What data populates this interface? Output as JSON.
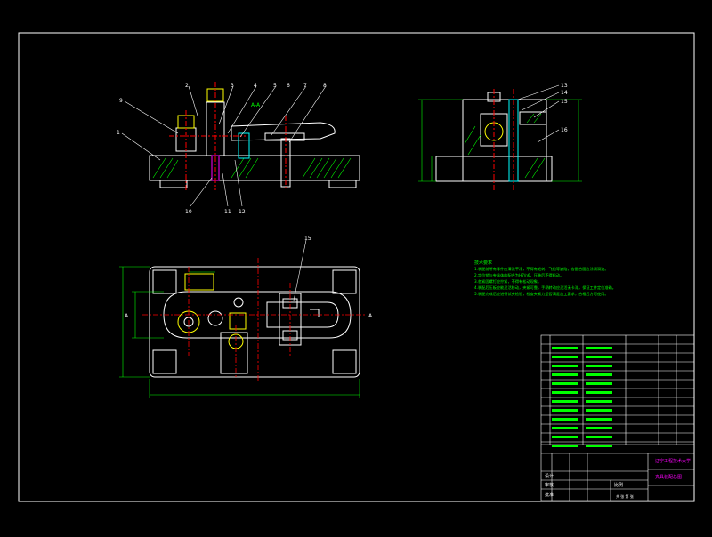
{
  "drawing": {
    "section_label": "A-A",
    "callouts_top": [
      "2",
      "3",
      "4",
      "5",
      "6",
      "7",
      "8",
      "9"
    ],
    "callout_left_1": "1",
    "callouts_bottom": [
      "10",
      "11",
      "12"
    ],
    "side_callouts": [
      "13",
      "14",
      "15",
      "16"
    ],
    "plan_callout": "15",
    "view_mark_left": "A",
    "view_mark_right": "A",
    "notes_title": "技术要求",
    "notes": [
      "1.装配前所有零件应清洗干净，不得有毛刺、飞边等缺陷，各配合面应涂润滑油。",
      "2.定位销与夹具体的配合为H7/n6，压装后不得松动。",
      "3.各紧固螺钉应拧紧，不得有松动现象。",
      "4.装配后压板应能灵活移动，夹紧可靠，手柄转动应灵活无卡滞，保证工件定位准确。",
      "5.装配完成后应进行试夹检验，检查夹紧力是否满足加工要求，合格后方可使用。"
    ],
    "title_block": {
      "school": "辽宁工程技术大学",
      "drawing_title": "夹具装配总图",
      "sign_labels": [
        "设计",
        "审核",
        "批准"
      ],
      "scale_label": "比例",
      "sheet_label": "共 张 第 张"
    }
  },
  "colors": {
    "line": "#ffffff",
    "accent": "#00ff00",
    "center": "#ff0000",
    "dim": "#00ff00",
    "highlight": "#ffff00",
    "magenta": "#ff00ff",
    "cyan": "#00ffff"
  }
}
